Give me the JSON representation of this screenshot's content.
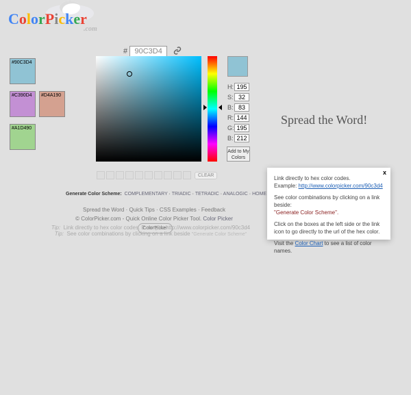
{
  "hex": {
    "prefix": "#",
    "value": "90C3D4"
  },
  "swatches": [
    {
      "label": "#90C3D4",
      "hex": "#90C3D4"
    },
    {
      "label": "#C390D4",
      "hex": "#C390D4"
    },
    {
      "label": "#D4A190",
      "hex": "#D4A190"
    },
    {
      "label": "#A1D490",
      "hex": "#A1D490"
    }
  ],
  "picker": {
    "preview_hex": "#90C3D4",
    "fields": {
      "H": "195",
      "S": "32",
      "B_hsv": "83",
      "R": "144",
      "G": "195",
      "B_rgb": "212"
    },
    "labels": {
      "H": "H:",
      "S": "S:",
      "Bh": "B:",
      "R": "R:",
      "G": "G:",
      "Br": "B:"
    },
    "add_btn": "Add to\nMy Colors"
  },
  "history": {
    "clear": "CLEAR"
  },
  "generate": {
    "label": "Generate Color Scheme:",
    "links": [
      "COMPLEMENTARY",
      "TRIADIC",
      "TETRADIC",
      "ANALOGIC",
      "HOME"
    ]
  },
  "footer": {
    "row1": "Spread the Word · Quick Tips · CSS Examples · Feedback",
    "row2_a": "© ColorPicker.com - Quick Online Color Picker Tool. ",
    "row2_link": "Color Picker",
    "row2_btn": "ColorPicker"
  },
  "tips": {
    "t1_label": "Tip:",
    "t1_text": "Link directly to hex color codes.   Example:   http://www.colorpicker.com/90c3d4",
    "t2_label": "Tip:",
    "t2_text": "See color combinations by clicking on a link beside ",
    "t2_quote": "\"Generate Color Scheme\""
  },
  "spread": "Spread the Word!",
  "popup": {
    "close": "x",
    "p1_a": "Link directly to hex color codes.",
    "p1_b": "Example: ",
    "p1_link": "http://www.colorpicker.com/90c3d4",
    "p2_a": "See color combinations by clicking on a link beside: ",
    "p2_b": "\"Generate Color Scheme\".",
    "p3": "Click on the boxes at the left side or the link icon to go directly to the url of the hex color.",
    "p4_a": "Visit the ",
    "p4_link": "Color Chart",
    "p4_b": " to see a list of color names."
  }
}
